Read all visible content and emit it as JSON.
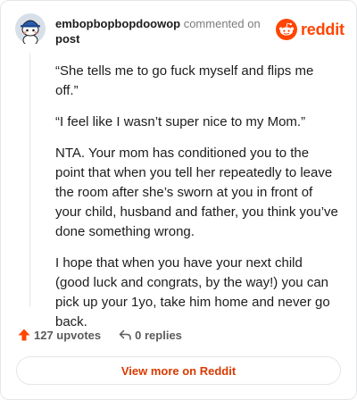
{
  "header": {
    "username": "embopbopbopdoowop",
    "action": "commented on",
    "target": "post",
    "brand_name": "reddit",
    "brand_color": "#ff4500",
    "avatar_icon": "snoo-avatar-icon"
  },
  "comment": {
    "paragraphs": [
      "“She tells me to go fuck myself and flips me off.”",
      "“I feel like I wasn’t super nice to my Mom.”",
      "NTA. Your mom has conditioned you to the point that when you tell her repeatedly to leave the room after she’s sworn at you in front of your child, husband and father, you think you’ve done something wrong.",
      "I hope that when you have your next child (good luck and congrats, by the way!) you can pick up your 1yo, take him home and never go back."
    ]
  },
  "stats": {
    "upvotes": "127 upvotes",
    "replies": "0 replies",
    "upvote_icon": "upvote-arrow-icon",
    "reply_icon": "reply-arrow-icon"
  },
  "footer": {
    "button_label": "View more on Reddit",
    "button_color": "#d93a00"
  }
}
